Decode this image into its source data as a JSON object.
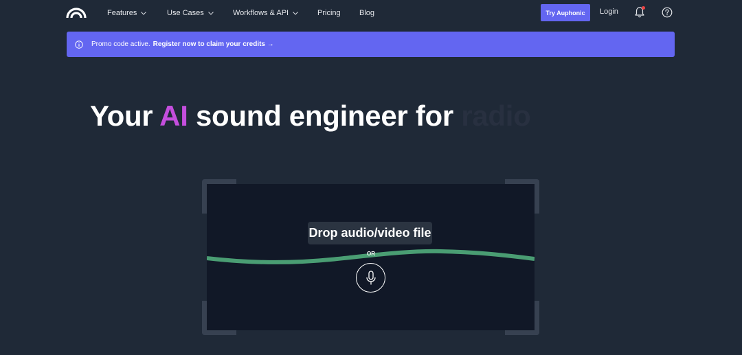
{
  "nav": {
    "logo": "auphonic-logo",
    "items": [
      {
        "label": "Features",
        "dropdown": true
      },
      {
        "label": "Use Cases",
        "dropdown": true
      },
      {
        "label": "Workflows & API",
        "dropdown": true
      },
      {
        "label": "Pricing",
        "dropdown": false
      },
      {
        "label": "Blog",
        "dropdown": false
      }
    ],
    "cta_label": "Try Auphonic",
    "login_label": "Login",
    "icons": {
      "notifications": "bell-icon",
      "help": "help-circle-icon"
    }
  },
  "promo": {
    "icon": "info-icon",
    "text": "Promo code active.",
    "link_label": "Register now to claim your credits →"
  },
  "hero": {
    "part1": "Your ",
    "accent": "AI",
    "part2": " sound engineer for ",
    "rotating_word": "radio"
  },
  "dropzone": {
    "label": "Drop audio/video file",
    "or_label": "OR",
    "record_icon": "microphone-icon"
  },
  "colors": {
    "background": "#1f2937",
    "accent": "#6366f1",
    "ai_highlight": "#c44edd",
    "wave": "#4a9d73",
    "dropzone_bg": "#111827"
  }
}
